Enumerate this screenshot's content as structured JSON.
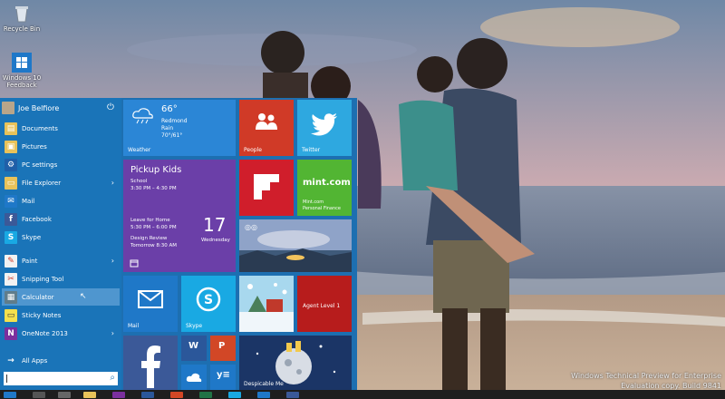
{
  "desktop": {
    "recycle_bin_label": "Recycle Bin",
    "win_icon_label": "Windows 10 Feedback"
  },
  "start_menu": {
    "user_name": "Joe Belfiore",
    "items": [
      {
        "label": "Documents",
        "has_arrow": false
      },
      {
        "label": "Pictures",
        "has_arrow": false
      },
      {
        "label": "PC settings",
        "has_arrow": false
      },
      {
        "label": "File Explorer",
        "has_arrow": true
      },
      {
        "label": "Mail",
        "has_arrow": false
      },
      {
        "label": "Facebook",
        "has_arrow": false
      },
      {
        "label": "Skype",
        "has_arrow": false
      },
      {
        "label": "Paint",
        "has_arrow": true
      },
      {
        "label": "Snipping Tool",
        "has_arrow": false
      },
      {
        "label": "Calculator",
        "has_arrow": false
      },
      {
        "label": "Sticky Notes",
        "has_arrow": false
      },
      {
        "label": "OneNote 2013",
        "has_arrow": true
      }
    ],
    "all_apps_label": "All Apps",
    "all_apps_arrow": "→"
  },
  "tiles": {
    "weather": {
      "temp": "66°",
      "city": "Redmond",
      "condition": "Rain",
      "range": "70°/61°",
      "label": "Weather"
    },
    "people": {
      "label": "People"
    },
    "twitter": {
      "label": "Twitter"
    },
    "calendar": {
      "title": "Pickup Kids",
      "line1": "School",
      "line2": "3:30 PM – 4:30 PM",
      "line3": "Leave for Home",
      "line4": "5:30 PM – 6:00 PM",
      "line5": "Design Review",
      "line6": "Tomorrow 8:30 AM",
      "day": "17",
      "weekday": "Wednesday"
    },
    "flipboard": {
      "label": ""
    },
    "mint": {
      "brand": "mint.com",
      "line1": "Mint.com",
      "line2": "Personal Finance"
    },
    "photo": {
      "label": ""
    },
    "mail": {
      "label": "Mail"
    },
    "skype": {
      "label": "Skype"
    },
    "game": {
      "label": ""
    },
    "agent": {
      "label": "Agent Level 1"
    },
    "facebook": {
      "label": ""
    },
    "despicable": {
      "label": "Despicable Me"
    }
  },
  "watermark": {
    "line1": "Windows Technical Preview for Enterprise",
    "line2": "Evaluation copy. Build 9841"
  },
  "colors": {
    "start_bg": "#1d6fb1",
    "people": "#d03a27",
    "twitter": "#2ea8e0",
    "calendar": "#6b3fa8",
    "flipboard": "#d01e2b",
    "mint": "#52b533",
    "mail": "#1f78c8",
    "skype": "#19a9e3",
    "agent": "#b71c1c",
    "facebook": "#3b5998"
  }
}
